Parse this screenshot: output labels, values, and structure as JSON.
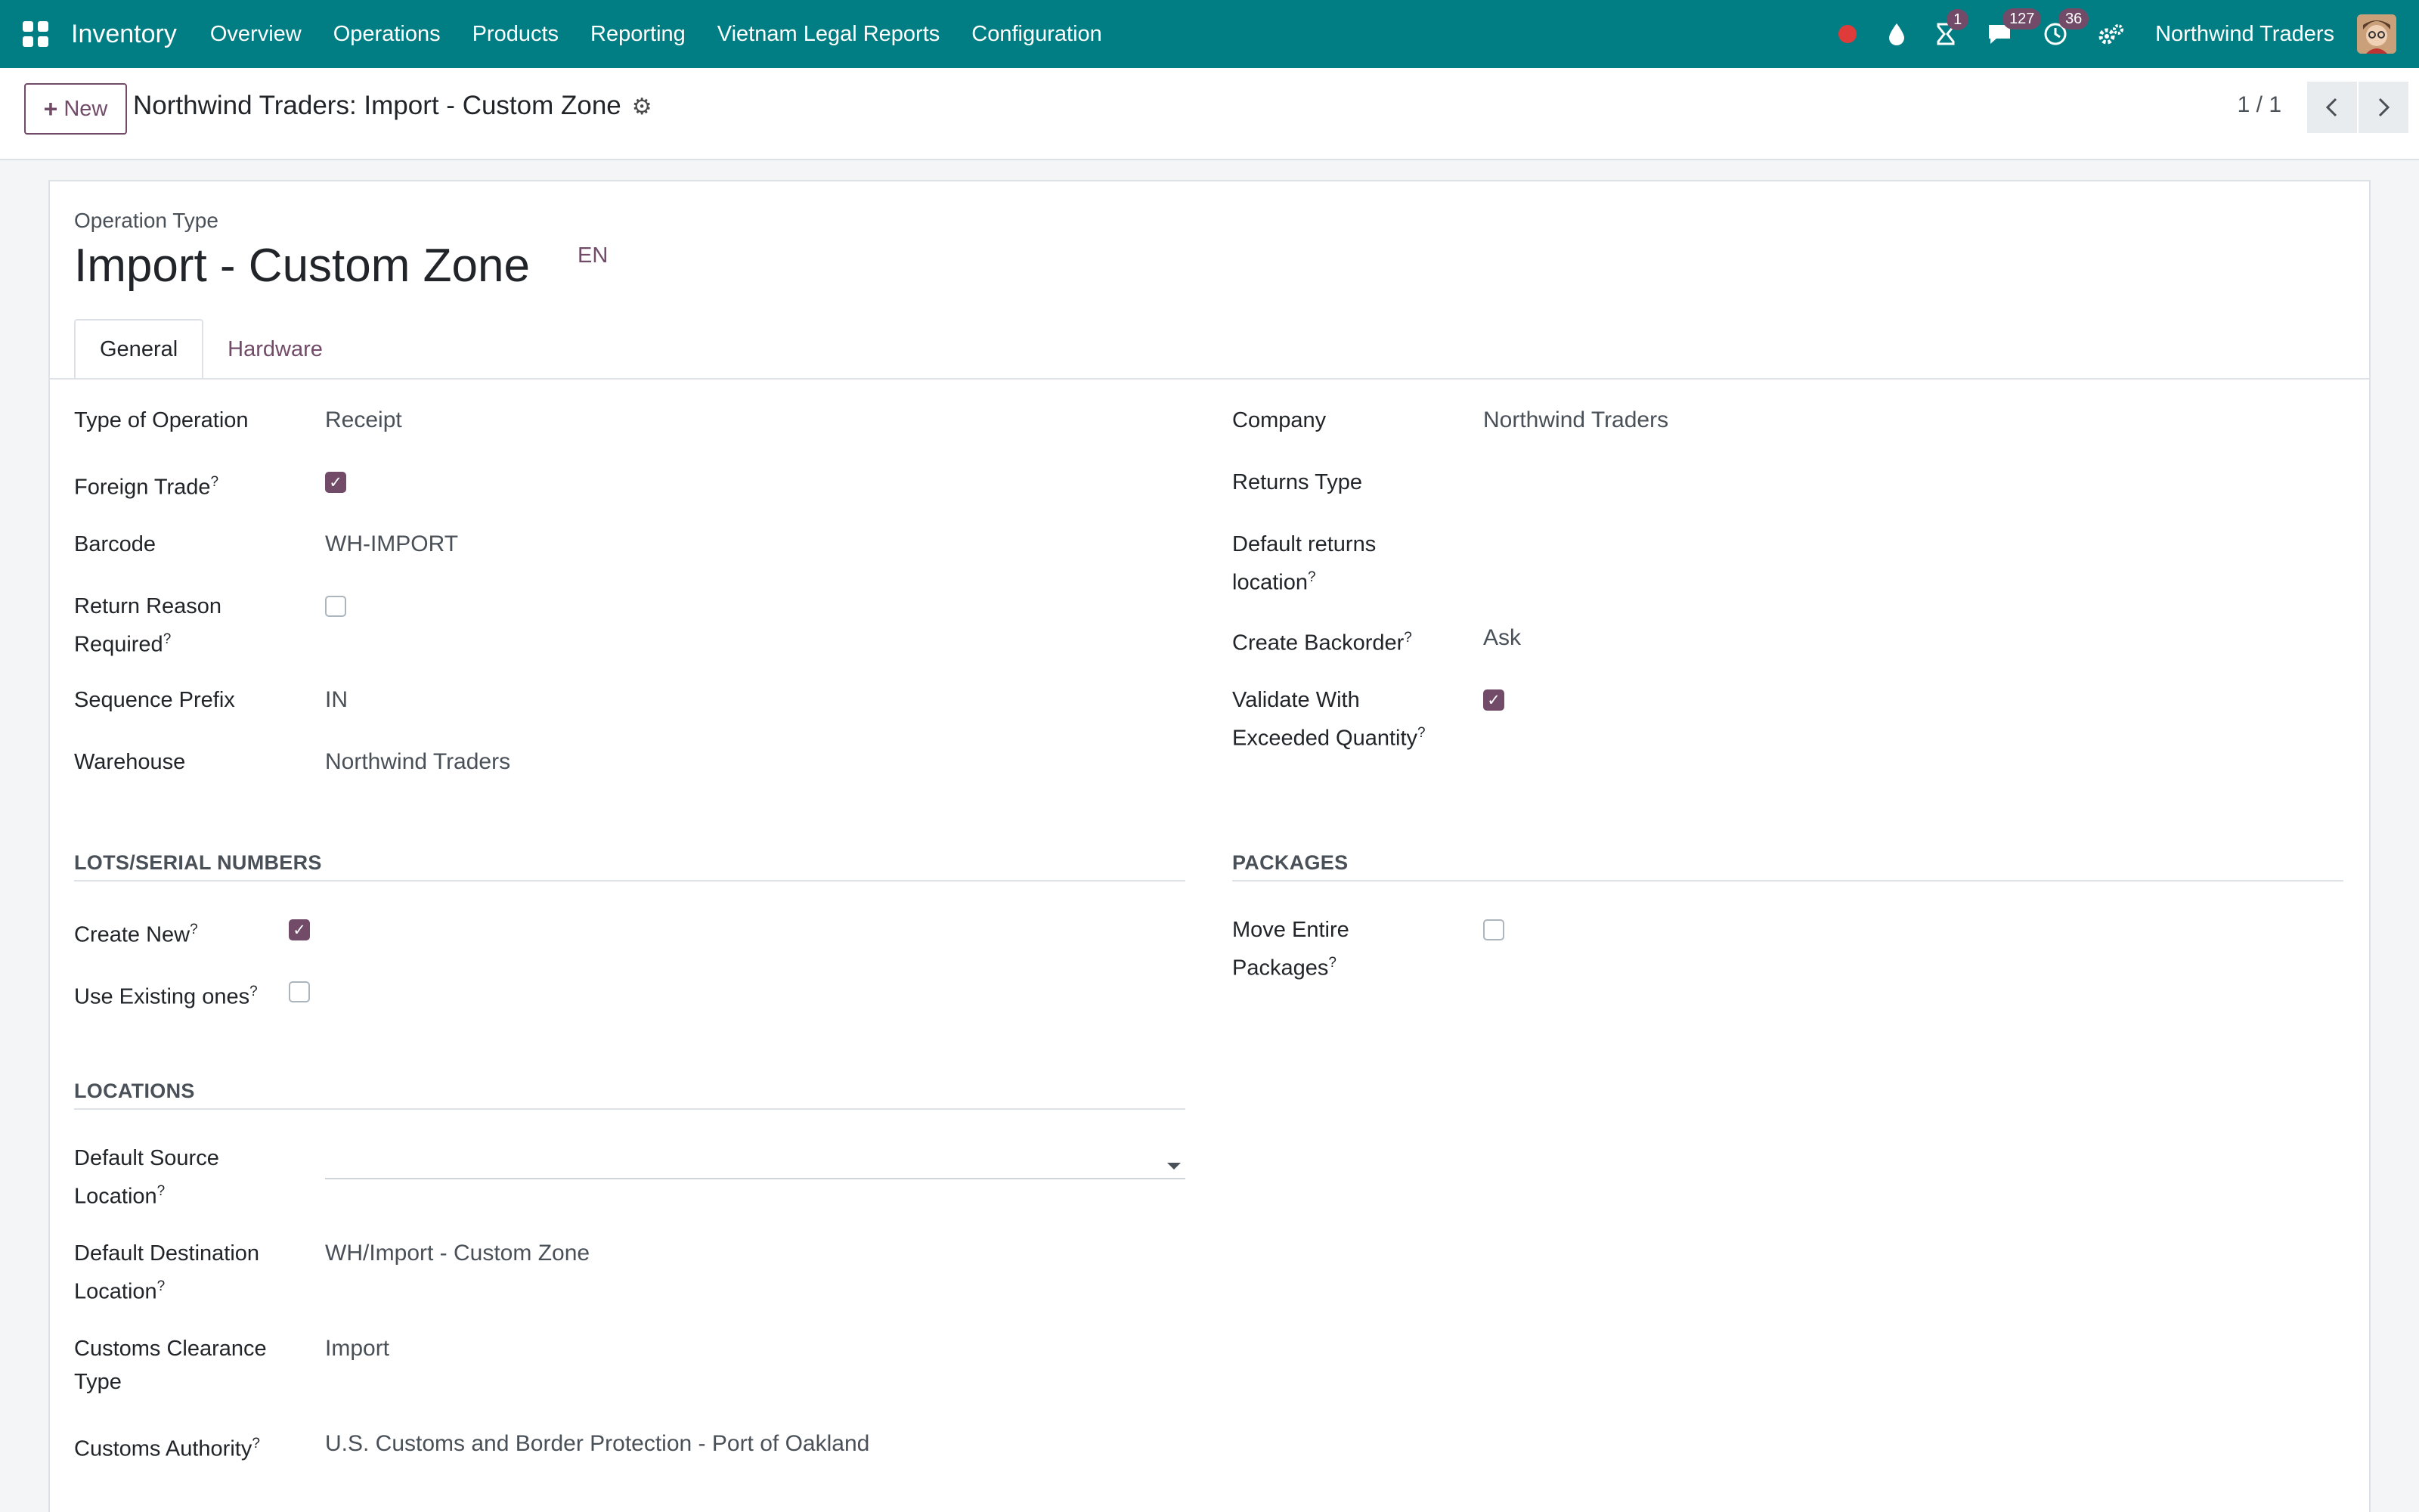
{
  "navbar": {
    "app_name": "Inventory",
    "menu": [
      "Overview",
      "Operations",
      "Products",
      "Reporting",
      "Vietnam Legal Reports",
      "Configuration"
    ],
    "badges": {
      "activities": "1",
      "messages": "127",
      "clock": "36"
    },
    "company": "Northwind Traders",
    "accent_color": "#017e84"
  },
  "control_panel": {
    "new_label": "New",
    "breadcrumb": "Northwind Traders: Import - Custom Zone",
    "pager": "1 / 1"
  },
  "form": {
    "record_type": "Operation Type",
    "title": "Import - Custom Zone",
    "lang": "EN",
    "tabs": [
      "General",
      "Hardware"
    ],
    "left": {
      "type_of_operation": {
        "label": "Type of Operation",
        "value": "Receipt"
      },
      "foreign_trade": {
        "label": "Foreign Trade",
        "checked": true
      },
      "barcode": {
        "label": "Barcode",
        "value": "WH-IMPORT"
      },
      "return_reason": {
        "label_1": "Return Reason",
        "label_2": "Required",
        "checked": false
      },
      "sequence_prefix": {
        "label": "Sequence Prefix",
        "value": "IN"
      },
      "warehouse": {
        "label": "Warehouse",
        "value": "Northwind Traders"
      }
    },
    "right": {
      "company": {
        "label": "Company",
        "value": "Northwind Traders"
      },
      "returns_type": {
        "label": "Returns Type",
        "value": ""
      },
      "default_returns_location": {
        "label_1": "Default returns",
        "label_2": "location",
        "value": ""
      },
      "create_backorder": {
        "label": "Create Backorder",
        "value": "Ask"
      },
      "validate_exceeded": {
        "label_1": "Validate With",
        "label_2": "Exceeded Quantity",
        "checked": true
      }
    },
    "lots": {
      "title": "LOTS/SERIAL NUMBERS",
      "create_new": {
        "label": "Create New",
        "checked": true
      },
      "use_existing": {
        "label": "Use Existing ones",
        "checked": false
      }
    },
    "packages": {
      "title": "PACKAGES",
      "move_entire": {
        "label_1": "Move Entire",
        "label_2": "Packages",
        "checked": false
      }
    },
    "locations": {
      "title": "LOCATIONS",
      "default_source": {
        "label_1": "Default Source",
        "label_2": "Location",
        "value": ""
      },
      "default_destination": {
        "label_1": "Default Destination",
        "label_2": "Location",
        "value": "WH/Import - Custom Zone"
      },
      "customs_clearance": {
        "label_1": "Customs Clearance",
        "label_2": "Type",
        "value": "Import"
      },
      "customs_authority": {
        "label": "Customs Authority",
        "value": "U.S. Customs and Border Protection - Port of Oakland"
      }
    },
    "help_mark": "?",
    "check_mark": "✓"
  }
}
